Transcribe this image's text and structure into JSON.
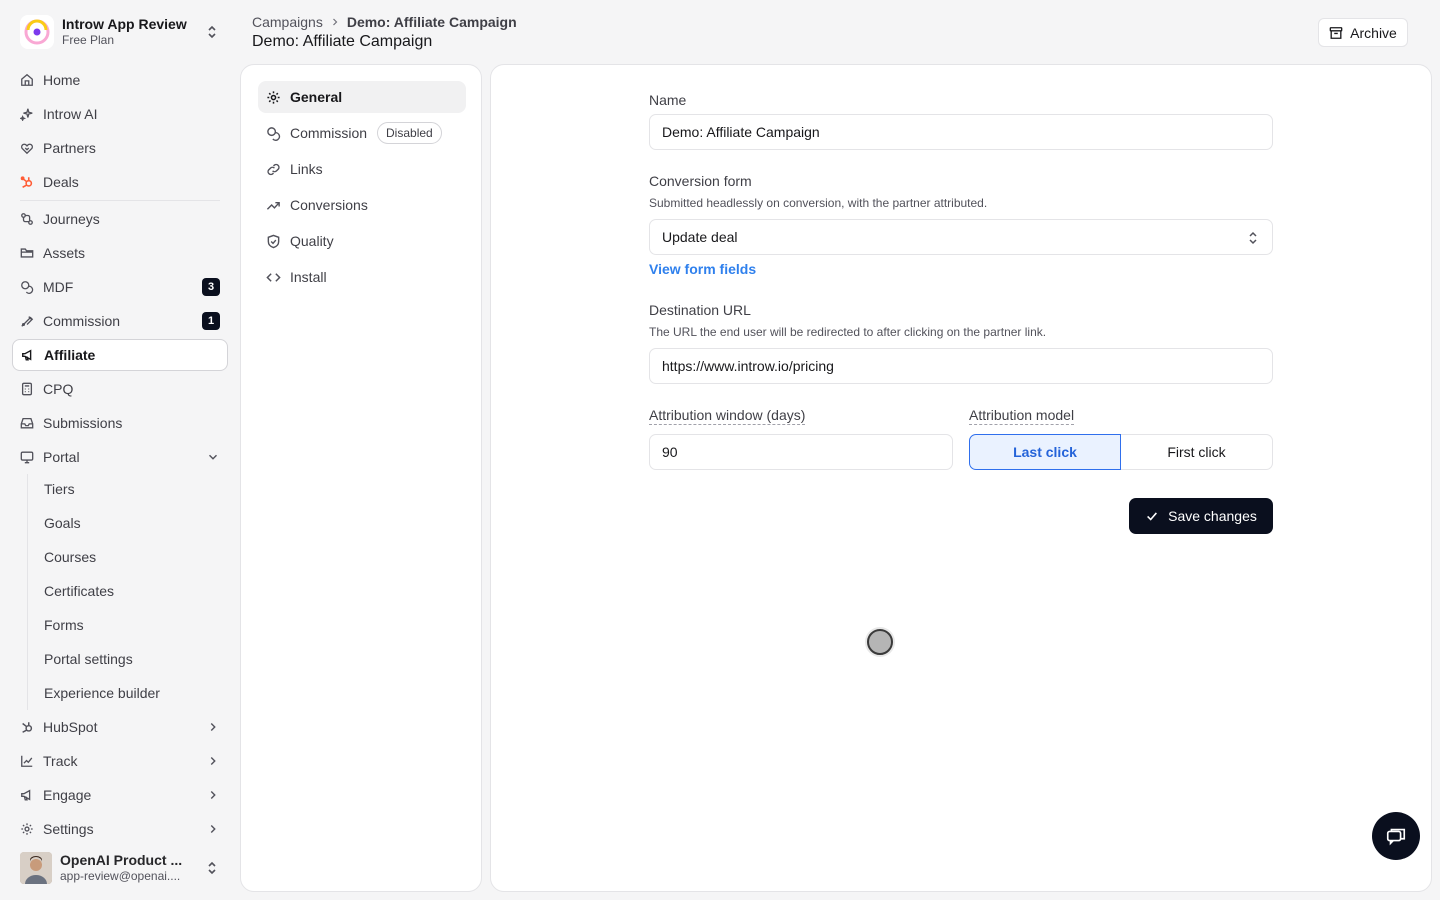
{
  "workspace": {
    "name": "Introw App Review",
    "plan": "Free Plan"
  },
  "sidebar": {
    "items": [
      {
        "label": "Home",
        "icon": "home-icon"
      },
      {
        "label": "Introw AI",
        "icon": "sparkles-icon"
      },
      {
        "label": "Partners",
        "icon": "handshake-icon"
      },
      {
        "label": "Deals",
        "icon": "hubspot-icon"
      },
      {
        "label": "Journeys",
        "icon": "workflow-icon"
      },
      {
        "label": "Assets",
        "icon": "folder-icon"
      },
      {
        "label": "MDF",
        "icon": "coins-icon",
        "badge": "3"
      },
      {
        "label": "Commission",
        "icon": "commission-icon",
        "badge": "1"
      },
      {
        "label": "Affiliate",
        "icon": "megaphone-icon"
      },
      {
        "label": "CPQ",
        "icon": "calculator-icon"
      },
      {
        "label": "Submissions",
        "icon": "inbox-icon"
      },
      {
        "label": "Portal",
        "icon": "monitor-icon"
      }
    ],
    "portal_sub": [
      "Tiers",
      "Goals",
      "Courses",
      "Certificates",
      "Forms",
      "Portal settings",
      "Experience builder"
    ],
    "groups": [
      {
        "label": "HubSpot",
        "icon": "hubspot-icon"
      },
      {
        "label": "Track",
        "icon": "chart-icon"
      },
      {
        "label": "Engage",
        "icon": "megaphone-icon"
      },
      {
        "label": "Settings",
        "icon": "gear-icon"
      }
    ],
    "user": {
      "name": "OpenAI Product ...",
      "email": "app-review@openai...."
    }
  },
  "header": {
    "breadcrumb_root": "Campaigns",
    "breadcrumb_current": "Demo: Affiliate Campaign",
    "title": "Demo: Affiliate Campaign",
    "archive_label": "Archive"
  },
  "subnav": {
    "items": [
      {
        "label": "General",
        "icon": "gear-icon"
      },
      {
        "label": "Commission",
        "icon": "coins-icon",
        "pill": "Disabled"
      },
      {
        "label": "Links",
        "icon": "link-icon"
      },
      {
        "label": "Conversions",
        "icon": "trending-up-icon"
      },
      {
        "label": "Quality",
        "icon": "shield-check-icon"
      },
      {
        "label": "Install",
        "icon": "code-icon"
      }
    ]
  },
  "form": {
    "name_label": "Name",
    "name_value": "Demo: Affiliate Campaign",
    "conversion_label": "Conversion form",
    "conversion_help": "Submitted headlessly on conversion, with the partner attributed.",
    "conversion_value": "Update deal",
    "view_fields": "View form fields",
    "dest_label": "Destination URL",
    "dest_help": "The URL the end user will be redirected to after clicking on the partner link.",
    "dest_value": "https://www.introw.io/pricing",
    "window_label": "Attribution window (days)",
    "window_value": "90",
    "model_label": "Attribution model",
    "model_options": [
      "Last click",
      "First click"
    ],
    "model_selected": "Last click",
    "save_label": "Save changes"
  },
  "colors": {
    "accent": "#2f6fed",
    "primary_button": "#0a0f1e",
    "hubspot": "#ff7a59"
  }
}
